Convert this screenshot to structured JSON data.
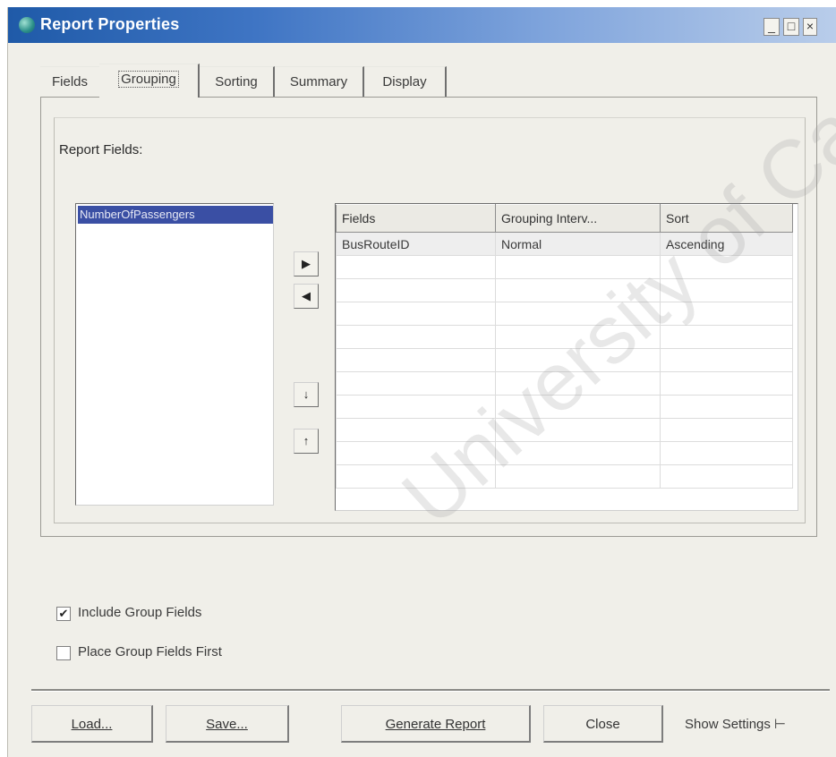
{
  "window": {
    "title": "Report Properties",
    "controls": {
      "minimize": "_",
      "maximize": "□",
      "close": "×"
    }
  },
  "tabs": [
    {
      "label": "Fields"
    },
    {
      "label": "Grouping",
      "active": true
    },
    {
      "label": "Sorting"
    },
    {
      "label": "Summary"
    },
    {
      "label": "Display"
    }
  ],
  "grouping": {
    "report_fields_label": "Report Fields:",
    "available_fields": [
      "NumberOfPassengers"
    ],
    "move_buttons": {
      "add": "▶",
      "remove": "◀",
      "down": "↓",
      "up": "↑"
    },
    "grid": {
      "columns": [
        "Fields",
        "Grouping Interv...",
        "Sort"
      ],
      "rows": [
        [
          "BusRouteID",
          "Normal",
          "Ascending"
        ]
      ]
    },
    "include_group_fields": {
      "label": "Include Group Fields",
      "checked": true,
      "mark": "✔"
    },
    "place_group_fields_first": {
      "label": "Place Group Fields First",
      "checked": false,
      "mark": ""
    }
  },
  "footer": {
    "load": "Load...",
    "save": "Save...",
    "generate_report": "Generate Report",
    "close": "Close",
    "show_settings": "Show Settings ⊢"
  },
  "watermark": "University of Cape Town",
  "colors": {
    "title_bar_start": "#1f5aa8",
    "title_bar_end": "#b9cdea",
    "selected_item": "#3a4fa4",
    "window_bg": "#f0efe9"
  }
}
